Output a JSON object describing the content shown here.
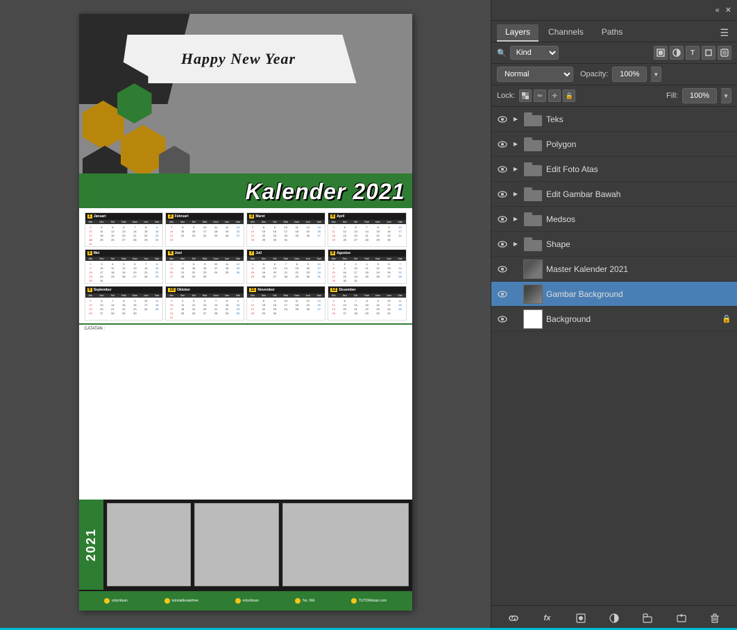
{
  "header": {
    "collapse_label": "«",
    "close_label": "✕"
  },
  "tabs": {
    "layers_label": "Layers",
    "channels_label": "Channels",
    "paths_label": "Paths"
  },
  "filter": {
    "kind_label": "Kind",
    "kind_value": "Kind",
    "pixel_icon": "🖼",
    "adjustment_icon": "◕",
    "type_icon": "T",
    "shape_icon": "⬜",
    "smart_icon": "📷"
  },
  "blend": {
    "mode_label": "Normal",
    "opacity_label": "Opacity:",
    "opacity_value": "100%"
  },
  "lock": {
    "label": "Lock:",
    "transparent_icon": "⬜",
    "paint_icon": "✏",
    "position_icon": "✛",
    "all_icon": "🔒",
    "fill_label": "Fill:",
    "fill_value": "100%"
  },
  "layers": [
    {
      "id": "teks",
      "name": "Teks",
      "type": "folder",
      "visible": true,
      "expanded": false,
      "selected": false,
      "locked": false
    },
    {
      "id": "polygon",
      "name": "Polygon",
      "type": "folder",
      "visible": true,
      "expanded": false,
      "selected": false,
      "locked": false
    },
    {
      "id": "edit-foto-atas",
      "name": "Edit Foto Atas",
      "type": "folder",
      "visible": true,
      "expanded": false,
      "selected": false,
      "locked": false
    },
    {
      "id": "edit-gambar-bawah",
      "name": "Edit Gambar Bawah",
      "type": "folder",
      "visible": true,
      "expanded": false,
      "selected": false,
      "locked": false
    },
    {
      "id": "medsos",
      "name": "Medsos",
      "type": "folder",
      "visible": true,
      "expanded": false,
      "selected": false,
      "locked": false
    },
    {
      "id": "shape",
      "name": "Shape",
      "type": "folder",
      "visible": true,
      "expanded": false,
      "selected": false,
      "locked": false
    },
    {
      "id": "master-kalender",
      "name": "Master Kalender 2021",
      "type": "image",
      "visible": true,
      "expanded": false,
      "selected": false,
      "locked": false
    },
    {
      "id": "gambar-background",
      "name": "Gambar Background",
      "type": "image",
      "visible": true,
      "expanded": false,
      "selected": true,
      "locked": false
    },
    {
      "id": "background",
      "name": "Background",
      "type": "solid",
      "visible": true,
      "expanded": false,
      "selected": false,
      "locked": true
    }
  ],
  "footer_buttons": [
    {
      "id": "link",
      "icon": "🔗",
      "label": "link-button"
    },
    {
      "id": "fx",
      "icon": "fx",
      "label": "fx-button"
    },
    {
      "id": "mask",
      "icon": "⬜",
      "label": "add-mask-button"
    },
    {
      "id": "adjustment",
      "icon": "◑",
      "label": "new-adjustment-button"
    },
    {
      "id": "group",
      "icon": "📁",
      "label": "new-group-button"
    },
    {
      "id": "new",
      "icon": "📄",
      "label": "new-layer-button"
    },
    {
      "id": "delete",
      "icon": "🗑",
      "label": "delete-layer-button"
    }
  ],
  "document": {
    "title": "Happy New Year",
    "subtitle": "Kalender 2021",
    "year": "2021",
    "months": [
      {
        "num": "1",
        "name": "Januari"
      },
      {
        "num": "2",
        "name": "Februari"
      },
      {
        "num": "3",
        "name": "Maret"
      },
      {
        "num": "4",
        "name": "April"
      },
      {
        "num": "5",
        "name": "Mei"
      },
      {
        "num": "6",
        "name": "Juni"
      },
      {
        "num": "7",
        "name": "Juli"
      },
      {
        "num": "8",
        "name": "Agustus"
      },
      {
        "num": "9",
        "name": "September"
      },
      {
        "num": "10",
        "name": "Oktober"
      },
      {
        "num": "11",
        "name": "November"
      },
      {
        "num": "12",
        "name": "Desember"
      }
    ],
    "notes_label": "CATATAN :"
  }
}
